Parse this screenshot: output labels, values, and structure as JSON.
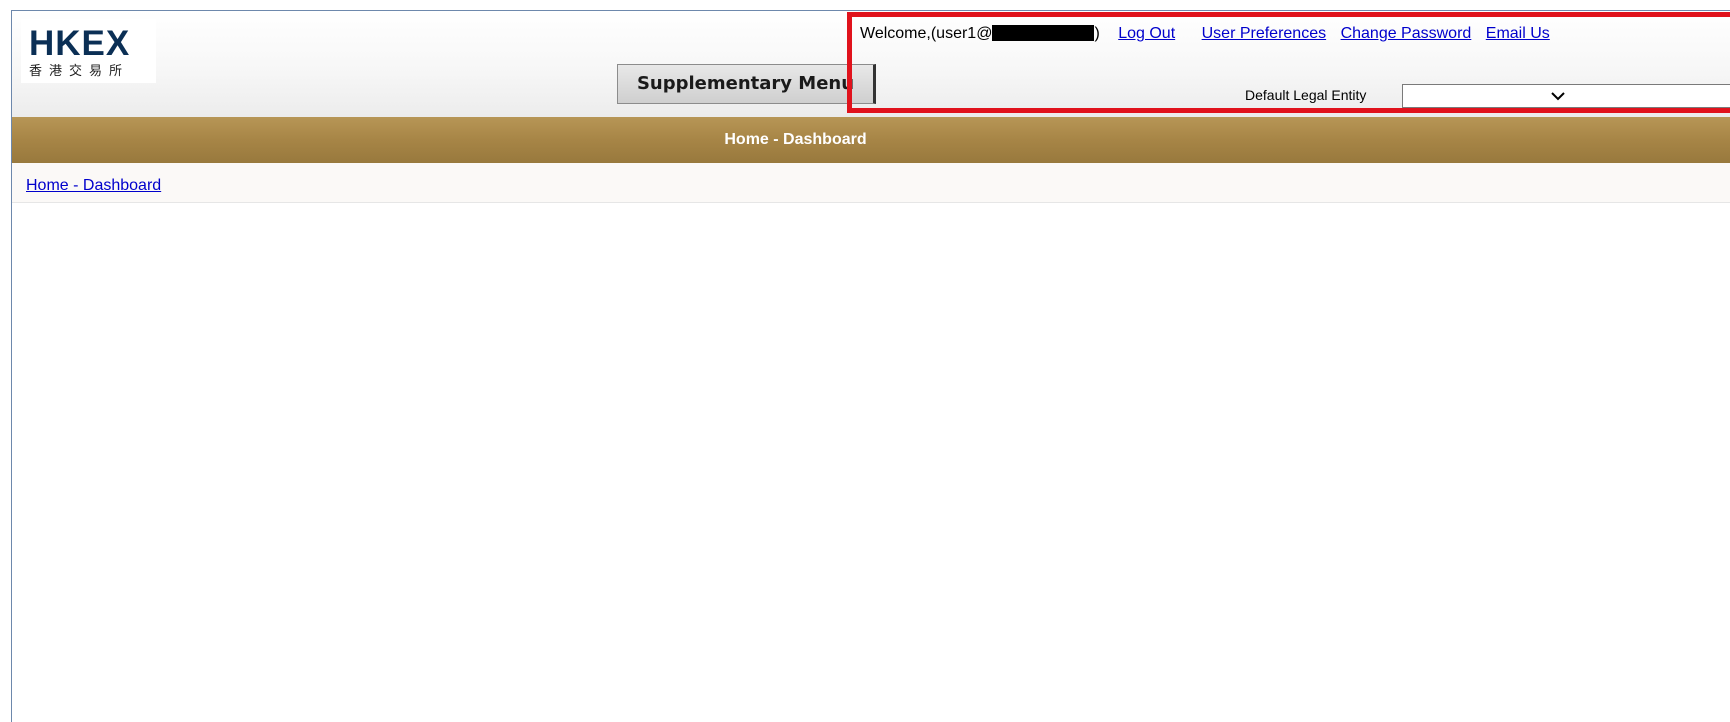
{
  "logo": {
    "text_en": "HKEX",
    "text_cn": "香港交易所"
  },
  "supplementary_menu": {
    "label": "Supplementary Menu"
  },
  "user_bar": {
    "welcome_prefix": "Welcome,(user1@",
    "welcome_suffix": ")",
    "links": {
      "log_out": "Log Out",
      "user_preferences": "User Preferences",
      "change_password": "Change Password",
      "email": "Email Us"
    }
  },
  "legal_entity": {
    "label": "Default Legal Entity",
    "value": ""
  },
  "title_bar": {
    "title": "Home - Dashboard"
  },
  "breadcrumb": {
    "label": "Home - Dashboard"
  },
  "colors": {
    "title_bar": "#a78546",
    "logo": "#0b2f55",
    "highlight": "#e0121c",
    "link": "#0000cc"
  }
}
